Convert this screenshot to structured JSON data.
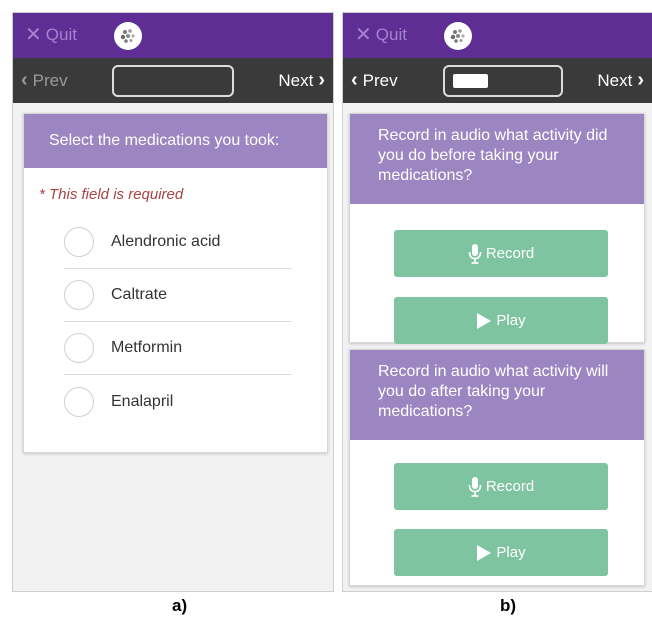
{
  "colors": {
    "topbar": "#5e2e94",
    "quit_text": "#a682d1",
    "navbar": "#3a3a3a",
    "card_header": "#9b86c1",
    "button": "#7fc4a0",
    "required_text": "#a94442"
  },
  "panel_a": {
    "topbar": {
      "quit_label": "Quit",
      "quit_icon": "close-icon",
      "logo_icon": "app-logo-icon"
    },
    "nav": {
      "prev_label": "Prev",
      "next_label": "Next",
      "progress": 0
    },
    "question": "Select the medications you took:",
    "required_note": "* This field is required",
    "options": [
      "Alendronic acid",
      "Caltrate",
      "Metformin",
      "Enalapril"
    ]
  },
  "panel_b": {
    "topbar": {
      "quit_label": "Quit",
      "quit_icon": "close-icon",
      "logo_icon": "app-logo-icon"
    },
    "nav": {
      "prev_label": "Prev",
      "next_label": "Next",
      "progress": 0.35
    },
    "questions": [
      {
        "text": "Record in audio what activity did you do before taking your medications?",
        "record_label": "Record",
        "record_icon": "microphone-icon",
        "play_label": "Play",
        "play_icon": "play-icon"
      },
      {
        "text": "Record in audio what activity will you do after taking your medications?",
        "record_label": "Record",
        "record_icon": "microphone-icon",
        "play_label": "Play",
        "play_icon": "play-icon"
      }
    ]
  },
  "captions": {
    "a": "a)",
    "b": "b)"
  }
}
